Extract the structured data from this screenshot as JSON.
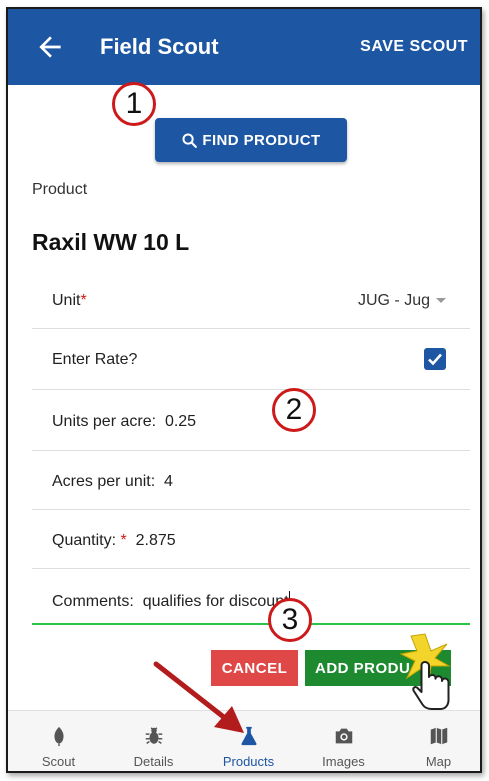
{
  "header": {
    "title": "Field Scout",
    "back_icon": "arrow-left-icon",
    "save_label": "SAVE SCOUT"
  },
  "find_product": {
    "label": "FIND PRODUCT",
    "icon": "search-icon"
  },
  "callouts": [
    "1",
    "2",
    "3"
  ],
  "product": {
    "label": "Product",
    "name": "Raxil WW 10 L"
  },
  "fields": {
    "unit": {
      "label": "Unit",
      "required_mark": "*",
      "value": "JUG - Jug"
    },
    "enter_rate": {
      "label": "Enter Rate?",
      "checked": true
    },
    "units_per_acre": {
      "label": "Units per acre:",
      "value": "0.25"
    },
    "acres_per_unit": {
      "label": "Acres per unit:",
      "value": "4"
    },
    "quantity": {
      "label": "Quantity:",
      "required_mark": "*",
      "value": "2.875"
    },
    "comments": {
      "label": "Comments:",
      "value": "qualifies for discount"
    }
  },
  "actions": {
    "cancel_label": "CANCEL",
    "add_label": "ADD PRODU"
  },
  "nav": [
    {
      "label": "Scout",
      "icon": "leaf-icon",
      "active": false
    },
    {
      "label": "Details",
      "icon": "bug-icon",
      "active": false
    },
    {
      "label": "Products",
      "icon": "flask-icon",
      "active": true
    },
    {
      "label": "Images",
      "icon": "camera-icon",
      "active": false
    },
    {
      "label": "Map",
      "icon": "map-icon",
      "active": false
    }
  ],
  "colors": {
    "primary": "#1d56a3",
    "cancel": "#e04848",
    "add": "#1e8a30",
    "focus_line": "#2bc24a",
    "callout_ring": "#cc1a1a",
    "arrow": "#b31c1c"
  }
}
